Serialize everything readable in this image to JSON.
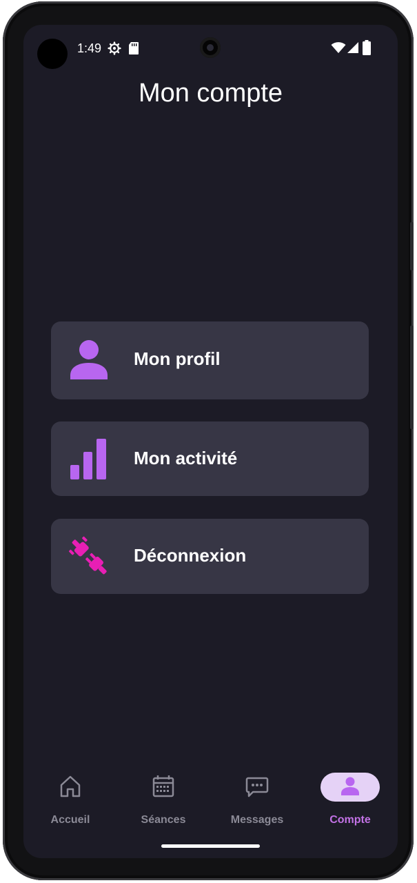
{
  "status_bar": {
    "time": "1:49",
    "icons": [
      "settings-gear-icon",
      "sd-card-icon",
      "wifi-icon",
      "signal-icon",
      "battery-icon"
    ]
  },
  "header": {
    "title": "Mon compte"
  },
  "menu": [
    {
      "label": "Mon profil",
      "icon": "person-icon",
      "icon_color": "#b866f0"
    },
    {
      "label": "Mon activité",
      "icon": "bar-chart-icon",
      "icon_color": "#b866f0"
    },
    {
      "label": "Déconnexion",
      "icon": "unplug-icon",
      "icon_color": "#e81fb4"
    }
  ],
  "bottom_nav": {
    "items": [
      {
        "label": "Accueil",
        "icon": "home-icon"
      },
      {
        "label": "Séances",
        "icon": "calendar-icon"
      },
      {
        "label": "Messages",
        "icon": "chat-icon"
      },
      {
        "label": "Compte",
        "icon": "person-icon"
      }
    ],
    "active": "Compte"
  },
  "colors": {
    "background": "#1c1b26",
    "card": "#373645",
    "accent": "#c372e6",
    "accent_pill": "#e5d2f6",
    "danger_icon": "#e81fb4",
    "inactive": "#8b8a96"
  }
}
